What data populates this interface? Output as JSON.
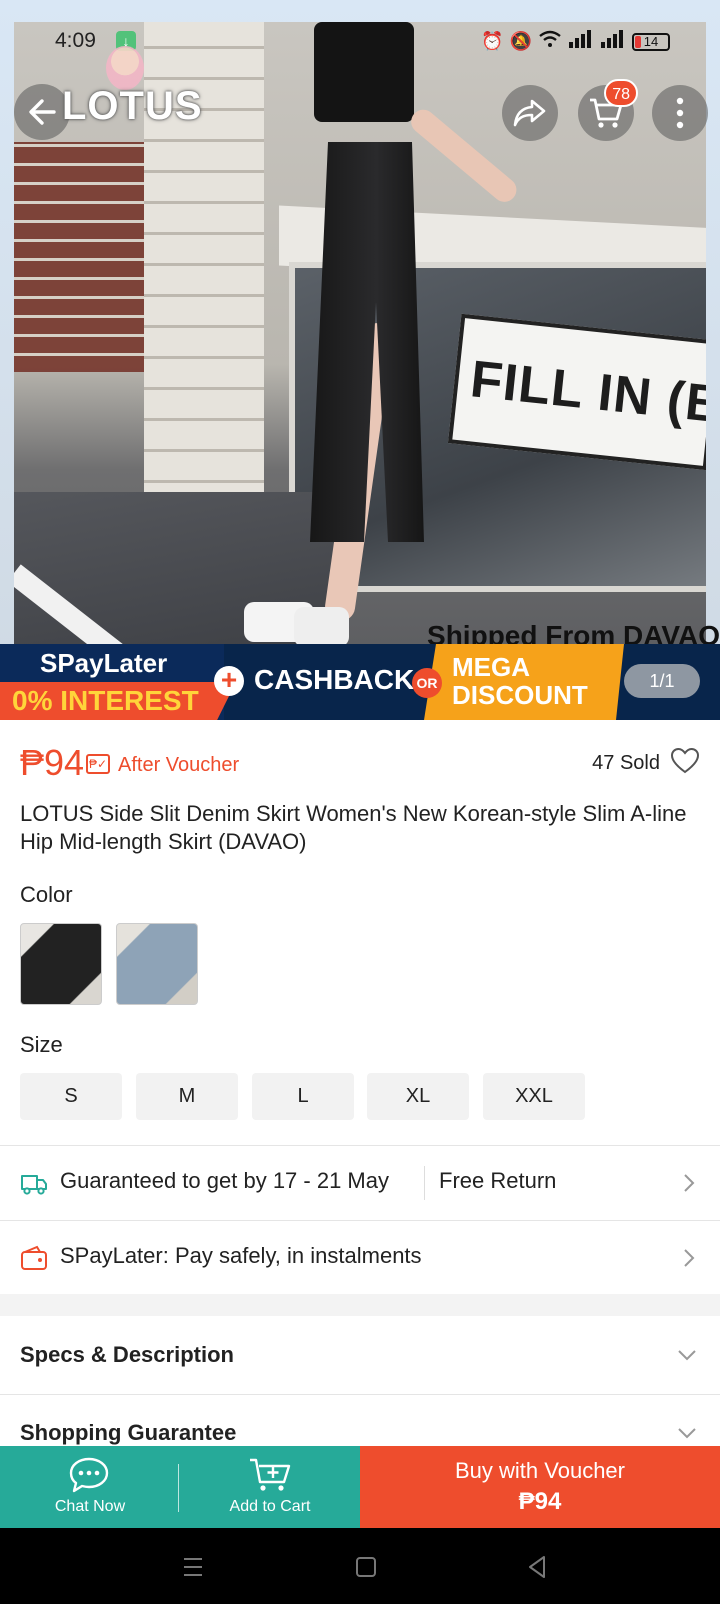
{
  "status_bar": {
    "time": "4:09",
    "battery": "14"
  },
  "overlay": {
    "brand": "LOTUS",
    "cart_count": "78"
  },
  "hero": {
    "sign_text": "FILL IN (BA",
    "shipped_text": "Shipped From DAVAO",
    "image_counter": "1/1"
  },
  "promo": {
    "spaylater": "SPayLater",
    "interest": "0% INTEREST",
    "cashback": "CASHBACK",
    "or": "OR",
    "mega_line1": "MEGA",
    "mega_line2": "DISCOUNT"
  },
  "product": {
    "price": "₱94",
    "after_voucher": "After Voucher",
    "sold": "47 Sold",
    "title": "LOTUS Side Slit Denim Skirt Women's New Korean-style Slim A-line Hip Mid-length Skirt (DAVAO)"
  },
  "variations": {
    "color_label": "Color",
    "size_label": "Size",
    "sizes": [
      "S",
      "M",
      "L",
      "XL",
      "XXL"
    ]
  },
  "info_rows": {
    "delivery": "Guaranteed to get by 17 - 21 May",
    "free_return": "Free Return",
    "spaylater": "SPayLater: Pay safely, in instalments"
  },
  "accordions": {
    "specs": "Specs & Description",
    "guarantee": "Shopping Guarantee"
  },
  "bottom_bar": {
    "chat": "Chat Now",
    "add_to_cart": "Add to Cart",
    "buy_line1": "Buy with Voucher",
    "buy_line2": "₱94"
  },
  "colors": {
    "accent": "#ee4d2d",
    "teal": "#26aa99",
    "mega": "#f6a21a",
    "navy": "#08254b"
  }
}
